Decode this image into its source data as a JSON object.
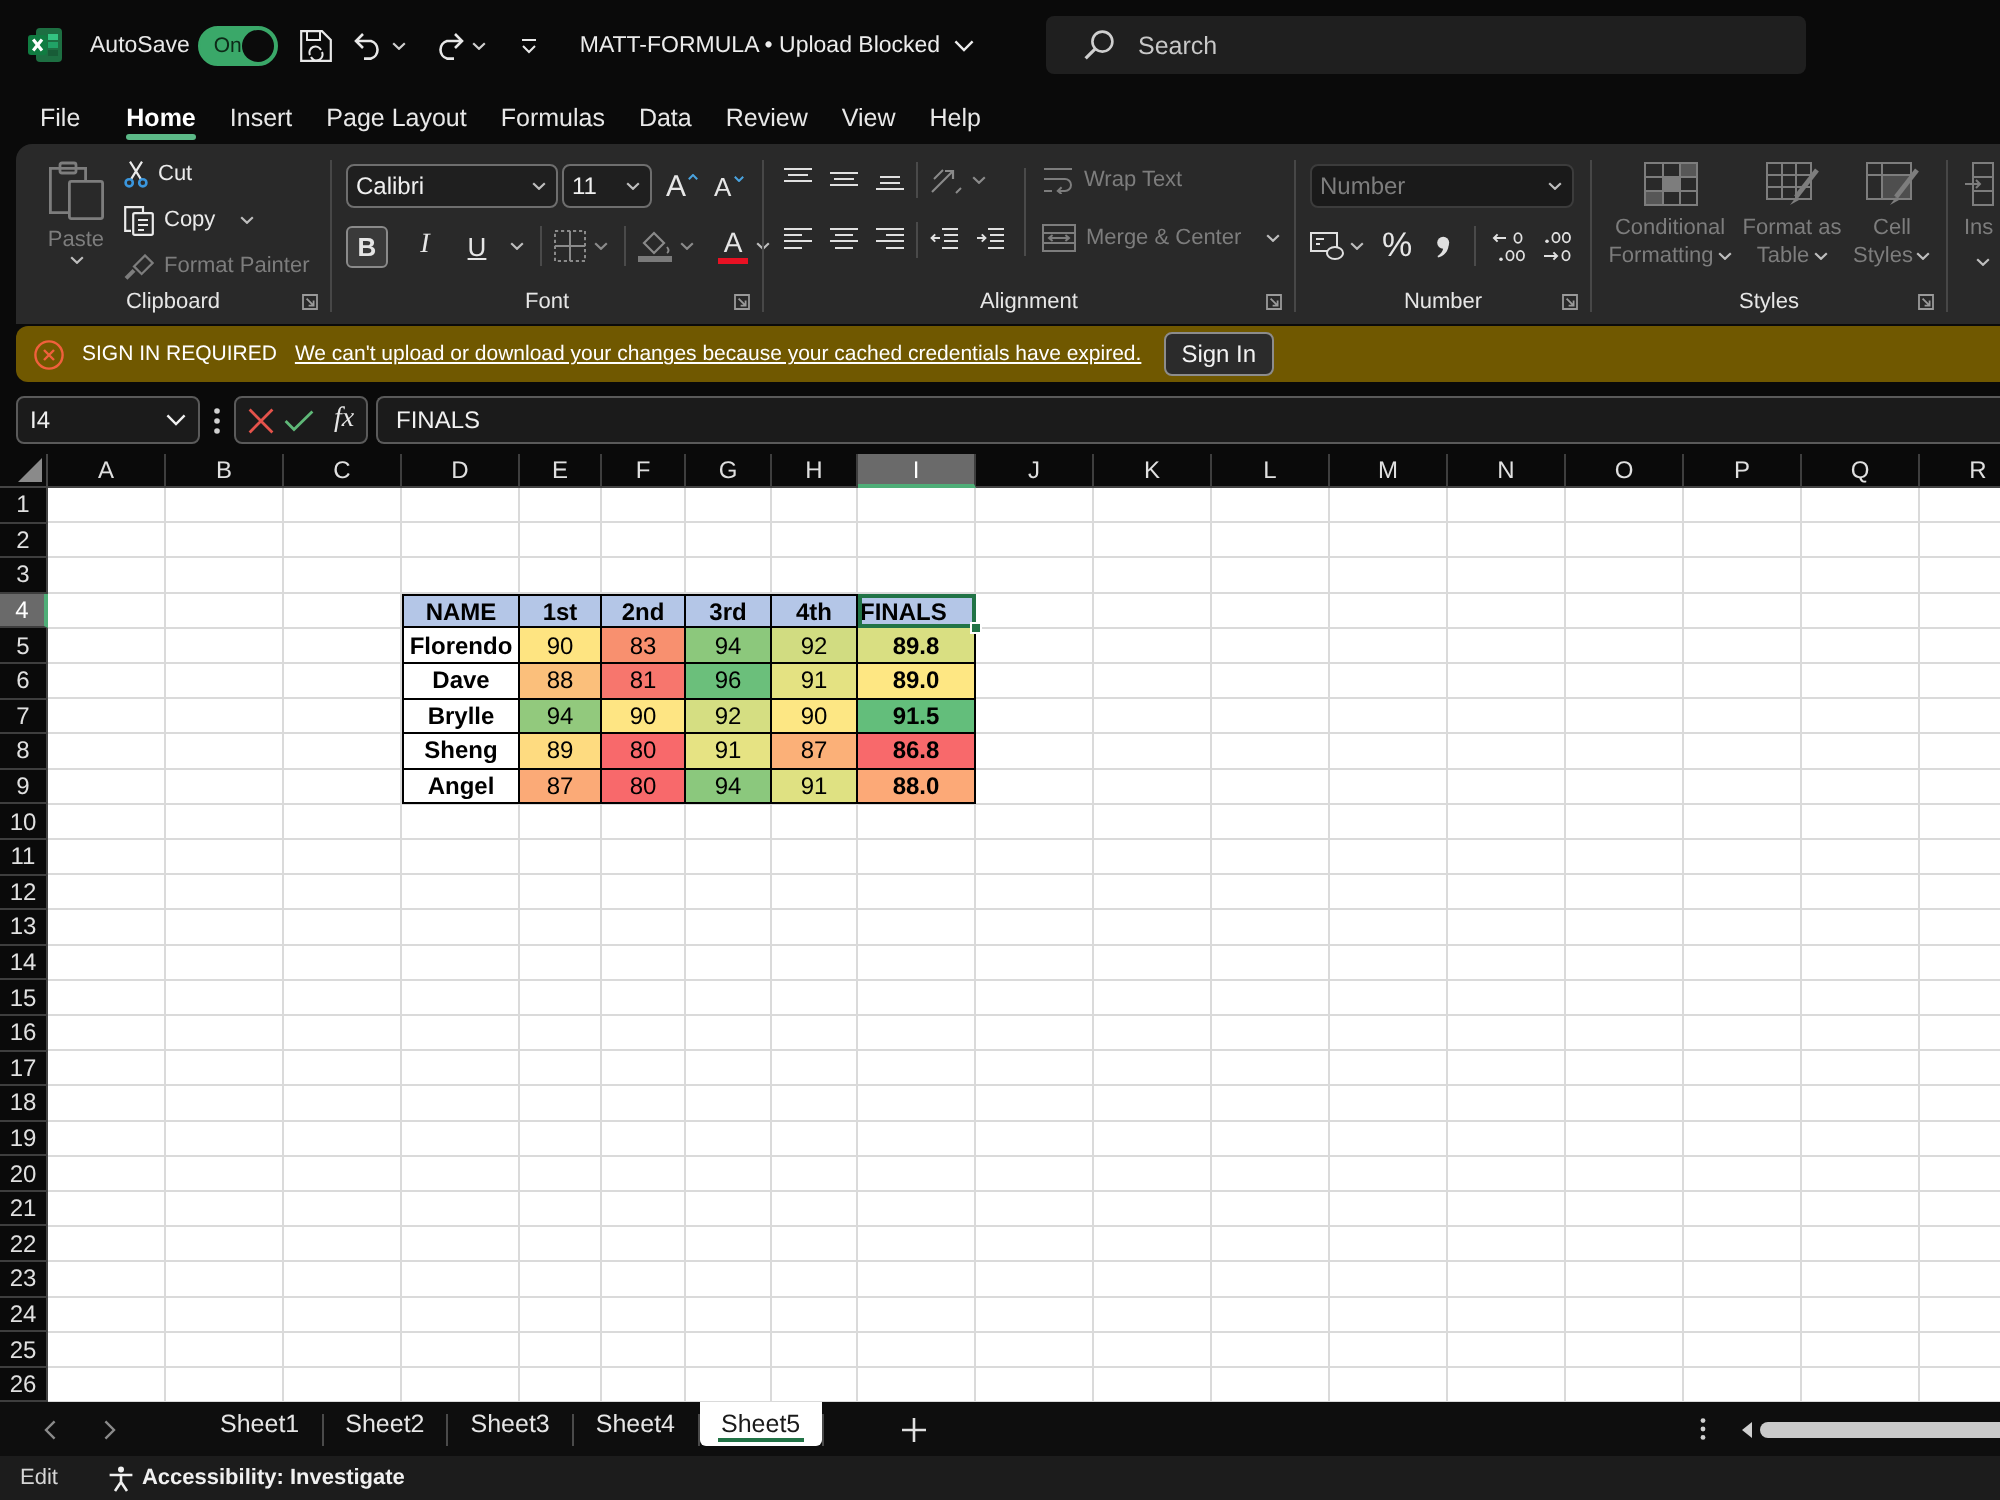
{
  "title_bar": {
    "autosave": {
      "label": "AutoSave",
      "toggle_label": "On",
      "on": true
    },
    "document_title": "MATT-FORMULA • Upload Blocked",
    "search": {
      "placeholder": "Search"
    }
  },
  "menu_tabs": [
    {
      "label": "File",
      "selected": false
    },
    {
      "label": "Home",
      "selected": true
    },
    {
      "label": "Insert",
      "selected": false
    },
    {
      "label": "Page Layout",
      "selected": false
    },
    {
      "label": "Formulas",
      "selected": false
    },
    {
      "label": "Data",
      "selected": false
    },
    {
      "label": "Review",
      "selected": false
    },
    {
      "label": "View",
      "selected": false
    },
    {
      "label": "Help",
      "selected": false
    }
  ],
  "ribbon": {
    "clipboard": {
      "label": "Clipboard",
      "paste": {
        "label": "Paste",
        "disabled": true
      },
      "cut": {
        "label": "Cut",
        "disabled": false
      },
      "copy": {
        "label": "Copy",
        "disabled": false
      },
      "format_painter": {
        "label": "Format Painter",
        "disabled": true
      }
    },
    "font": {
      "label": "Font",
      "font_name": "Calibri",
      "font_size": "11",
      "grow_font": "A",
      "shrink_font": "A",
      "format_buttons": [
        {
          "kind": "bold",
          "label": "B",
          "selected": true
        },
        {
          "kind": "italic",
          "label": "I",
          "selected": false
        },
        {
          "kind": "underline",
          "label": "U",
          "selected": false
        }
      ],
      "font_color": "A"
    },
    "alignment": {
      "label": "Alignment",
      "wrap_text": {
        "label": "Wrap Text",
        "disabled": true
      },
      "merge_center": {
        "label": "Merge & Center",
        "disabled": true
      }
    },
    "number": {
      "label": "Number",
      "format": {
        "value": "Number",
        "disabled": true
      },
      "percent": "%"
    },
    "styles": {
      "label": "Styles",
      "buttons": [
        {
          "label": "Conditional Formatting",
          "disabled": true
        },
        {
          "label": "Format as Table",
          "disabled": true
        },
        {
          "label": "Cell Styles",
          "disabled": true
        }
      ]
    },
    "group_6": {
      "buttons": [
        {
          "label": "Ins",
          "disabled": true
        }
      ]
    }
  },
  "notification": {
    "title": "SIGN IN REQUIRED",
    "message": "We can't upload or download your changes because your cached credentials have expired.",
    "button": "Sign In"
  },
  "formula_bar": {
    "name_box": "I4",
    "function_label": "fx",
    "formula": "FINALS"
  },
  "sheet": {
    "columns": [
      {
        "label": "A",
        "selected": false
      },
      {
        "label": "B",
        "selected": false
      },
      {
        "label": "C",
        "selected": false
      },
      {
        "label": "D",
        "selected": false
      },
      {
        "label": "E",
        "selected": false
      },
      {
        "label": "F",
        "selected": false
      },
      {
        "label": "G",
        "selected": false
      },
      {
        "label": "H",
        "selected": false
      },
      {
        "label": "I",
        "selected": true
      },
      {
        "label": "J",
        "selected": false
      },
      {
        "label": "K",
        "selected": false
      },
      {
        "label": "L",
        "selected": false
      },
      {
        "label": "M",
        "selected": false
      },
      {
        "label": "N",
        "selected": false
      },
      {
        "label": "O",
        "selected": false
      },
      {
        "label": "P",
        "selected": false
      },
      {
        "label": "Q",
        "selected": false
      },
      {
        "label": "R",
        "selected": false
      }
    ],
    "rows": [
      {
        "label": "1",
        "selected": false
      },
      {
        "label": "2",
        "selected": false
      },
      {
        "label": "3",
        "selected": false
      },
      {
        "label": "4",
        "selected": true
      },
      {
        "label": "5",
        "selected": false
      },
      {
        "label": "6",
        "selected": false
      },
      {
        "label": "7",
        "selected": false
      },
      {
        "label": "8",
        "selected": false
      },
      {
        "label": "9",
        "selected": false
      },
      {
        "label": "10",
        "selected": false
      },
      {
        "label": "11",
        "selected": false
      },
      {
        "label": "12",
        "selected": false
      },
      {
        "label": "13",
        "selected": false
      },
      {
        "label": "14",
        "selected": false
      },
      {
        "label": "15",
        "selected": false
      },
      {
        "label": "16",
        "selected": false
      },
      {
        "label": "17",
        "selected": false
      },
      {
        "label": "18",
        "selected": false
      },
      {
        "label": "19",
        "selected": false
      },
      {
        "label": "20",
        "selected": false
      },
      {
        "label": "21",
        "selected": false
      },
      {
        "label": "22",
        "selected": false
      },
      {
        "label": "23",
        "selected": false
      },
      {
        "label": "24",
        "selected": false
      },
      {
        "label": "25",
        "selected": false
      },
      {
        "label": "26",
        "selected": false
      }
    ],
    "table": {
      "header": [
        {
          "label": "NAME",
          "selected": false
        },
        {
          "label": "1st",
          "selected": false
        },
        {
          "label": "2nd",
          "selected": false
        },
        {
          "label": "3rd",
          "selected": false
        },
        {
          "label": "4th",
          "selected": false
        },
        {
          "label": "FINALS",
          "selected": true
        }
      ],
      "rows": [
        {
          "name": "Florendo",
          "scores": [
            {
              "value": "90",
              "color": "#fee481"
            },
            {
              "value": "83",
              "color": "#f8906f"
            },
            {
              "value": "94",
              "color": "#8cc87c"
            },
            {
              "value": "92",
              "color": "#d1dc81"
            }
          ],
          "final": {
            "value": "89.8",
            "color": "#d9df82"
          }
        },
        {
          "name": "Dave",
          "scores": [
            {
              "value": "88",
              "color": "#fbbf7b"
            },
            {
              "value": "81",
              "color": "#f7766d"
            },
            {
              "value": "96",
              "color": "#6bbf7b"
            },
            {
              "value": "91",
              "color": "#e4e282"
            }
          ],
          "final": {
            "value": "89.0",
            "color": "#fee783"
          }
        },
        {
          "name": "Brylle",
          "scores": [
            {
              "value": "94",
              "color": "#92c97d"
            },
            {
              "value": "90",
              "color": "#fee583"
            },
            {
              "value": "92",
              "color": "#d5de82"
            },
            {
              "value": "90",
              "color": "#fde784"
            }
          ],
          "final": {
            "value": "91.5",
            "color": "#63be7b"
          }
        },
        {
          "name": "Sheng",
          "scores": [
            {
              "value": "89",
              "color": "#fedb80"
            },
            {
              "value": "80",
              "color": "#f8696b"
            },
            {
              "value": "91",
              "color": "#e6e383"
            },
            {
              "value": "87",
              "color": "#fbb078"
            }
          ],
          "final": {
            "value": "86.8",
            "color": "#f8696b"
          }
        },
        {
          "name": "Angel",
          "scores": [
            {
              "value": "87",
              "color": "#fbaa77"
            },
            {
              "value": "80",
              "color": "#f8696b"
            },
            {
              "value": "94",
              "color": "#8bc87d"
            },
            {
              "value": "91",
              "color": "#dfe182"
            }
          ],
          "final": {
            "value": "88.0",
            "color": "#fca977"
          }
        }
      ]
    }
  },
  "sheet_tabs": [
    {
      "label": "Sheet1",
      "selected": false
    },
    {
      "label": "Sheet2",
      "selected": false
    },
    {
      "label": "Sheet3",
      "selected": false
    },
    {
      "label": "Sheet4",
      "selected": false
    },
    {
      "label": "Sheet5",
      "selected": true
    }
  ],
  "status_bar": {
    "mode": "Edit",
    "accessibility": "Accessibility: Investigate"
  }
}
